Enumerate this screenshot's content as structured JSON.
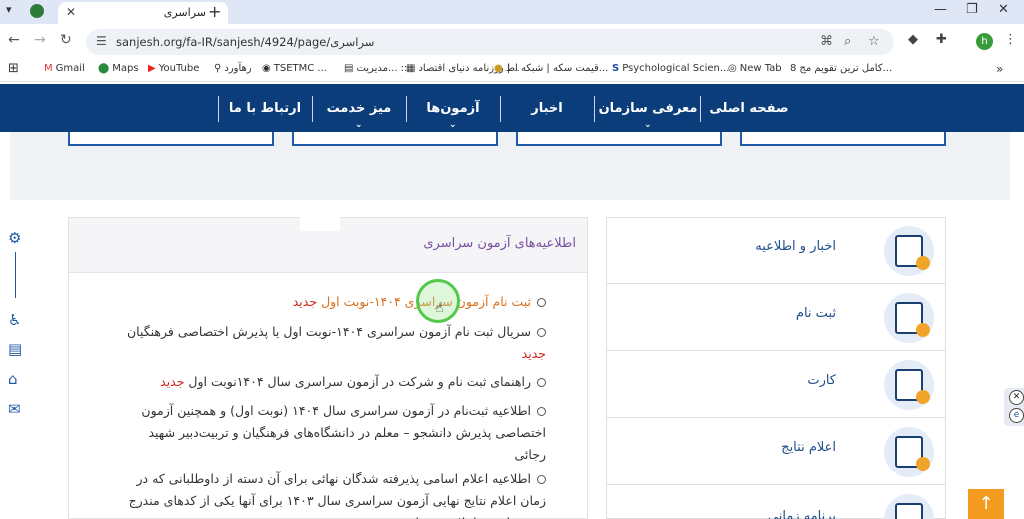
{
  "browser": {
    "tab_title": "سراسری",
    "url": "sanjesh.org/fa-IR/sanjesh/4924/page/سراسری",
    "bookmarks": [
      {
        "label": "Gmail",
        "icon": "gmail-icon"
      },
      {
        "label": "Maps",
        "icon": "maps-icon"
      },
      {
        "label": "YouTube",
        "icon": "youtube-icon"
      },
      {
        "label": "رهآورد",
        "icon": "pin-icon"
      },
      {
        "label": "TSETMC ...",
        "icon": "globe-icon"
      },
      {
        "label": "مديريت... ::",
        "icon": "page-icon"
      },
      {
        "label": "روزنامه دنیای اقتصاد |...",
        "icon": "news-icon"
      },
      {
        "label": "قیمت سکه | شبکه اط...",
        "icon": "coin-icon"
      },
      {
        "label": "Psychological Scien...",
        "icon": "s-icon"
      },
      {
        "label": "New Tab",
        "icon": "chrome-icon"
      },
      {
        "label": "کامل ترین تقویم مج...",
        "icon": "calendar-icon"
      }
    ],
    "profile_initial": "h"
  },
  "site_nav": {
    "items": [
      {
        "label": "صفحه اصلی"
      },
      {
        "label": "معرفی سازمان"
      },
      {
        "label": "اخبار"
      },
      {
        "label": "آزمون‌ها"
      },
      {
        "label": "میز خدمت"
      },
      {
        "label": "ارتباط با ما"
      }
    ]
  },
  "announcements": {
    "title": "اطلاعیه‌های آزمون سراسری",
    "items": [
      {
        "text": "ثبت نام آزمون سراسری ۱۴۰۴-نوبت اول ",
        "tag": "جدید"
      },
      {
        "text": "سریال ثبت نام آزمون سراسری ۱۴۰۴-نوبت اول یا پذیرش اختصاصی فرهنگیان ",
        "tag": "جدید"
      },
      {
        "text": "راهنمای ثبت نام و شرکت در آزمون سراسری سال ۱۴۰۴نوبت اول ",
        "tag": "جدید"
      },
      {
        "text": "اطلاعیه ثبت‌نام در آزمون سراسری  سال ۱۴۰۴ (نوبت اول) و همچنین آزمون اختصاصی پذیرش دانشجو – معلم در دانشگاه‌های فرهنگیان و تربیت‌دبیر شهید رجائی",
        "tag": ""
      },
      {
        "text": "اطلاعیه اعلام اسامی پذیرفته شدگان نهائی برای آن دسته از داوطلبانی که در زمان اعلام نتایج نهایی آزمون سراسری سال ۱۴۰۳ برای آنها یکی از کدهای مندرج در جدول زیر اعلام شده است",
        "tag": ""
      }
    ]
  },
  "sidebar": {
    "items": [
      {
        "label": "اخبار و اطلاعیه"
      },
      {
        "label": "ثبت نام"
      },
      {
        "label": "کارت"
      },
      {
        "label": "اعلام نتایج"
      },
      {
        "label": "برنامه زمانی"
      }
    ]
  },
  "colors": {
    "nav_bg": "#0a3d7a",
    "accent_new": "#d1261f",
    "announce_title": "#7a4fa3",
    "scroll_top": "#f39c1f"
  }
}
